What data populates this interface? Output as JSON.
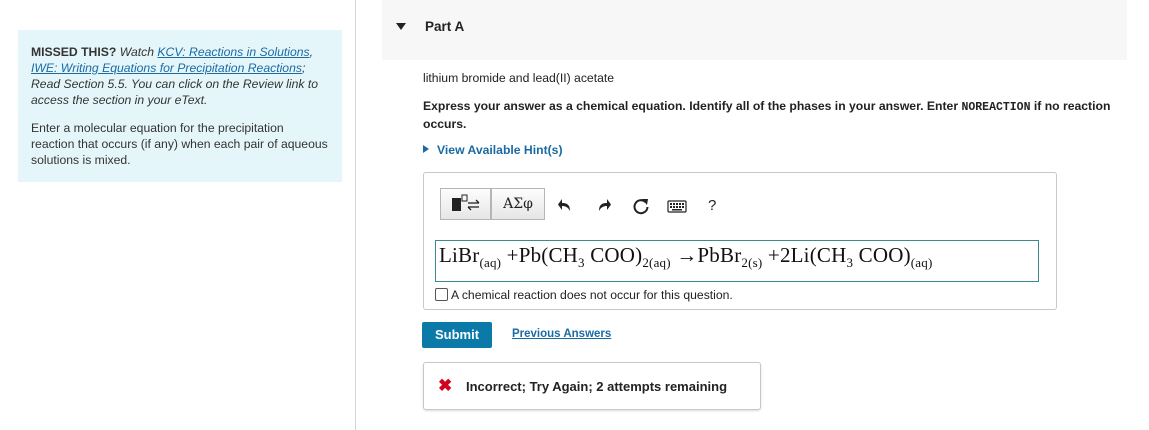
{
  "sidebar": {
    "missed_label": "MISSED THIS?",
    "watch_text": " Watch ",
    "link1": "KCV: Reactions in Solutions",
    "sep": ", ",
    "link2": "IWE: Writing Equations for Precipitation Reactions",
    "read_text": "; Read Section 5.5. You can click on the Review link to access the section in your eText.",
    "instructions": "Enter a molecular equation for the precipitation reaction that occurs (if any) when each pair of aqueous solutions is mixed."
  },
  "part": {
    "title": "Part A"
  },
  "question": {
    "reactants": "lithium bromide and lead(II) acetate",
    "express_a": "Express your answer as a chemical equation. Identify all of the phases in your answer. Enter ",
    "express_code": "NOREACTION",
    "express_b": " if no reaction occurs.",
    "hint_label": "View Available Hint(s)"
  },
  "toolbar": {
    "greek": "ΑΣφ",
    "undo_icon": "undo-icon",
    "redo_icon": "redo-icon",
    "reset_icon": "reset-icon",
    "keyboard_icon": "keyboard-icon",
    "help": "?"
  },
  "equation": {
    "t1": "LiBr",
    "s1": "(aq)",
    "t2": " +Pb(CH",
    "s2": "3",
    "t3": " COO)",
    "s3": "2(aq)",
    "t4": " →PbBr",
    "s4": "2(s)",
    "t5": " +2Li(CH",
    "s5": "3",
    "t6": " COO)",
    "s6": "(aq)"
  },
  "no_reaction_label": "A chemical reaction does not occur for this question.",
  "actions": {
    "submit": "Submit",
    "previous": "Previous Answers"
  },
  "feedback": {
    "icon": "✖",
    "message": "Incorrect; Try Again; 2 attempts remaining",
    "error_color": "#d0021b"
  },
  "colors": {
    "accent": "#0b7aa8",
    "link": "#1a6aa3",
    "info_bg": "#e5f6fb"
  }
}
